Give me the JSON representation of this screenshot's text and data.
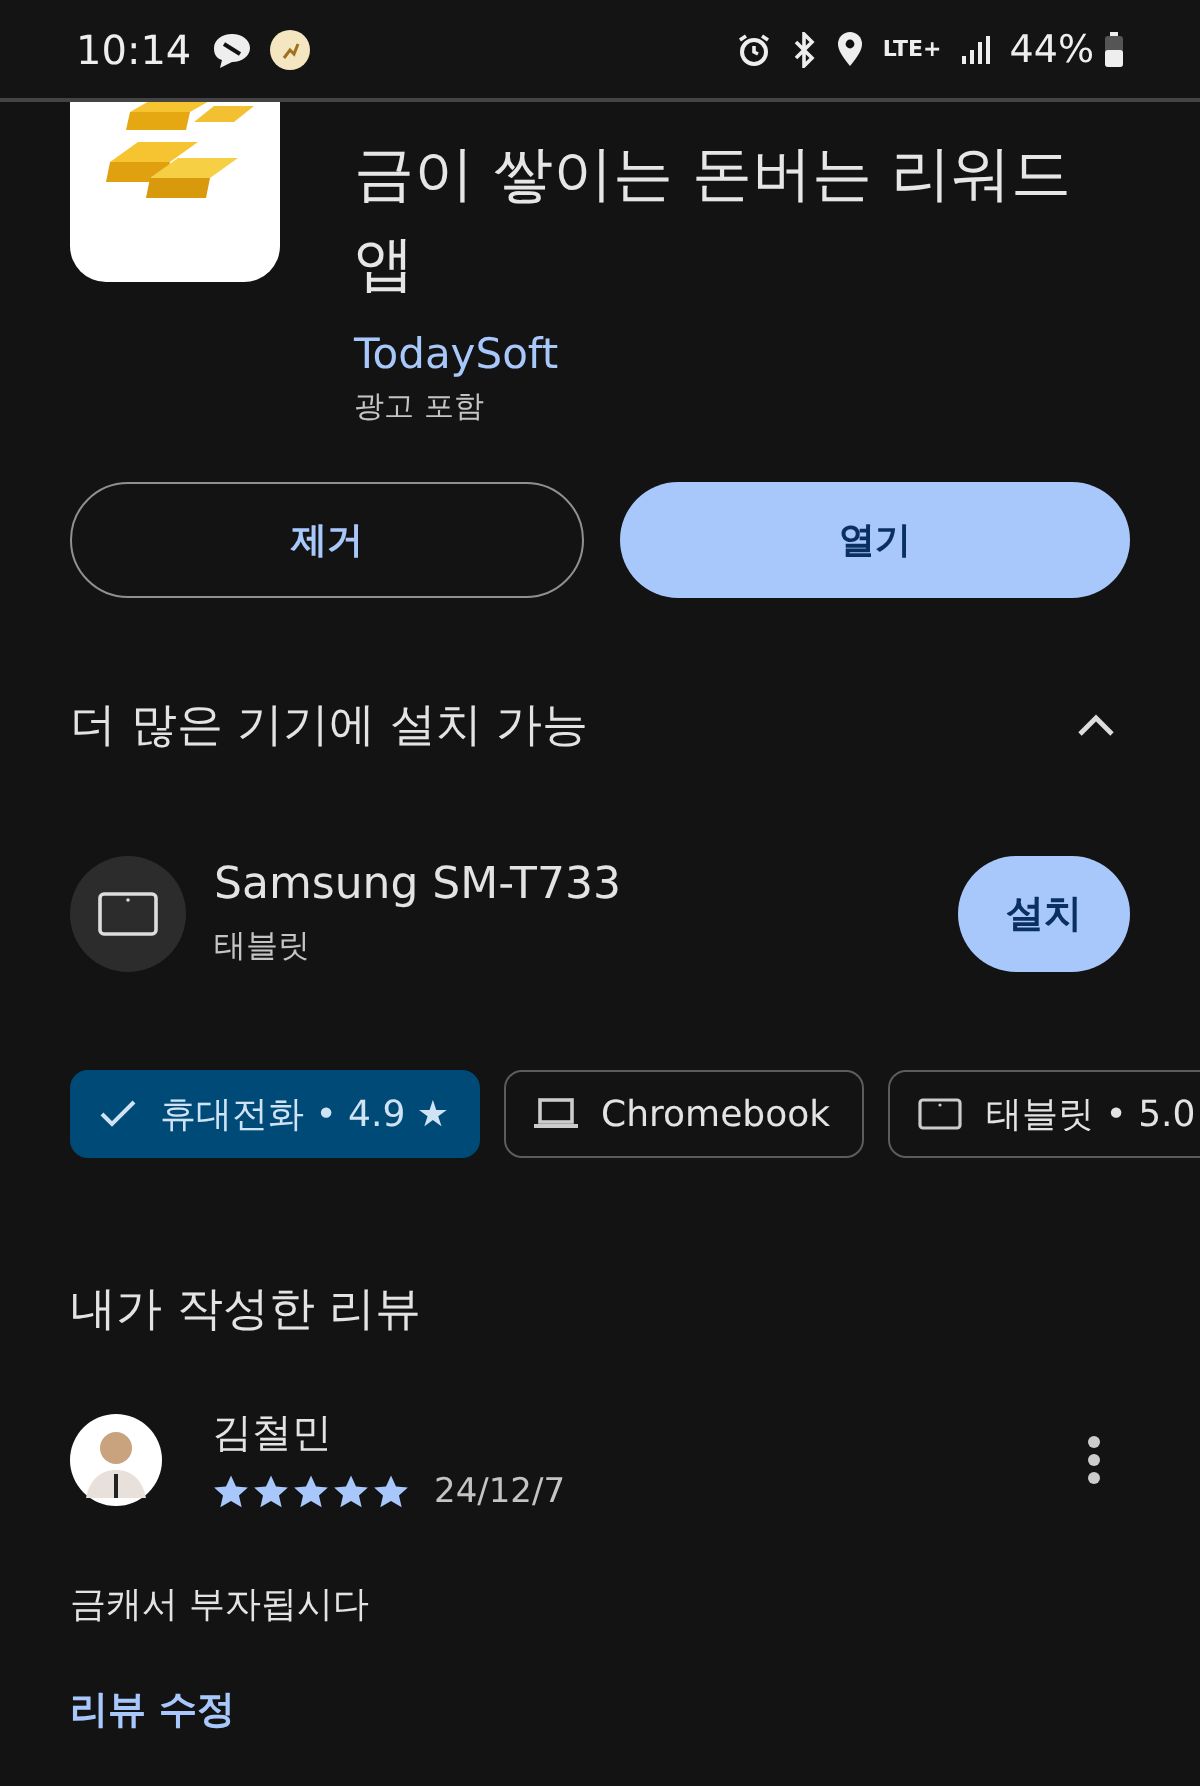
{
  "status_bar": {
    "time": "10:14",
    "network": "LTE+",
    "battery": "44%"
  },
  "app": {
    "title": "금이 쌓이는 돈버는 리워드 앱",
    "developer": "TodaySoft",
    "note": "광고 포함"
  },
  "actions": [
    {
      "label": "제거",
      "kind": "outline"
    },
    {
      "label": "열기",
      "kind": "filled"
    }
  ],
  "devices_section": {
    "title": "더 많은 기기에 설치 가능",
    "expanded": true,
    "devices": [
      {
        "name": "Samsung SM-T733",
        "type": "태블릿",
        "button": "설치"
      }
    ]
  },
  "device_chips": [
    {
      "label": "휴대전화 • 4.9 ★",
      "selected": true
    },
    {
      "label": "Chromebook",
      "kind": "laptop",
      "selected": false
    },
    {
      "label": "태블릿 • 5.0",
      "kind": "tablet",
      "selected": false
    }
  ],
  "my_review": {
    "title": "내가 작성한 리뷰",
    "author": "김철민",
    "stars": 5,
    "date": "24/12/7",
    "text": "금캐서 부자됩시다",
    "edit_link": "리뷰 수정"
  }
}
